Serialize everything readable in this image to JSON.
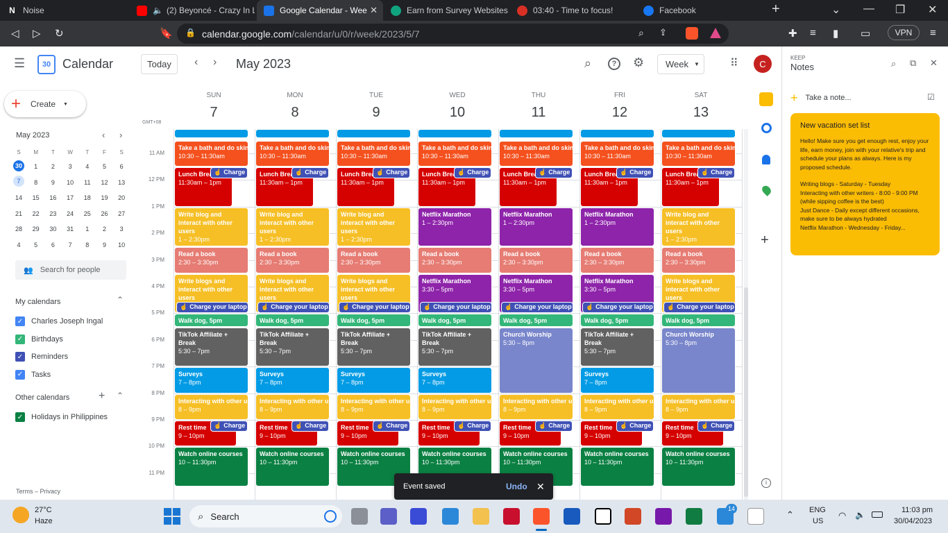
{
  "browser": {
    "tabs": [
      {
        "label": "Noise",
        "color": "#202124",
        "glyph": "N"
      },
      {
        "label": "(2) Beyoncé - Crazy In Lo",
        "color": "#ff0000",
        "glyph": "▶"
      },
      {
        "label": "Google Calendar - Wee",
        "color": "#1a73e8",
        "glyph": "30"
      },
      {
        "label": "Earn from Survey Websites.",
        "color": "#10a37f",
        "glyph": "◎"
      },
      {
        "label": "03:40 - Time to focus!",
        "color": "#d93025",
        "glyph": "✓"
      },
      {
        "label": "Facebook",
        "color": "#1877f2",
        "glyph": "f"
      }
    ],
    "url_domain": "calendar.google.com",
    "url_path": "/calendar/u/0/r/week/2023/5/7",
    "vpn_label": "VPN"
  },
  "calendar": {
    "app_name": "Calendar",
    "logo_day": "30",
    "today_button": "Today",
    "month_label": "May 2023",
    "view_select": "Week",
    "avatar_letter": "C",
    "timezone": "GMT+08",
    "days": [
      {
        "name": "SUN",
        "num": "7"
      },
      {
        "name": "MON",
        "num": "8"
      },
      {
        "name": "TUE",
        "num": "9"
      },
      {
        "name": "WED",
        "num": "10"
      },
      {
        "name": "THU",
        "num": "11"
      },
      {
        "name": "FRI",
        "num": "12"
      },
      {
        "name": "SAT",
        "num": "13"
      }
    ],
    "hours": [
      "11 AM",
      "12 PM",
      "1 PM",
      "2 PM",
      "3 PM",
      "4 PM",
      "5 PM",
      "6 PM",
      "7 PM",
      "8 PM",
      "9 PM",
      "10 PM",
      "11 PM"
    ]
  },
  "sidebar": {
    "create_label": "Create",
    "mini_month": "May 2023",
    "weekday_letters": [
      "S",
      "M",
      "T",
      "W",
      "T",
      "F",
      "S"
    ],
    "weeks": [
      [
        "30",
        "1",
        "2",
        "3",
        "4",
        "5",
        "6"
      ],
      [
        "7",
        "8",
        "9",
        "10",
        "11",
        "12",
        "13"
      ],
      [
        "14",
        "15",
        "16",
        "17",
        "18",
        "19",
        "20"
      ],
      [
        "21",
        "22",
        "23",
        "24",
        "25",
        "26",
        "27"
      ],
      [
        "28",
        "29",
        "30",
        "31",
        "1",
        "2",
        "3"
      ],
      [
        "4",
        "5",
        "6",
        "7",
        "8",
        "9",
        "10"
      ]
    ],
    "search_people": "Search for people",
    "my_calendars_title": "My calendars",
    "my_calendars": [
      {
        "label": "Charles Joseph Ingal",
        "color": "#4285f4"
      },
      {
        "label": "Birthdays",
        "color": "#33b679"
      },
      {
        "label": "Reminders",
        "color": "#3f51b5"
      },
      {
        "label": "Tasks",
        "color": "#4285f4"
      }
    ],
    "other_calendars_title": "Other calendars",
    "other_calendars": [
      {
        "label": "Holidays in Philippines",
        "color": "#0b8043"
      }
    ],
    "footer": "Terms – Privacy"
  },
  "events": {
    "bath_title": "Take a bath and do skin",
    "bath_time": "10:30 – 11:30am",
    "lunch_title": "Lunch Break",
    "lunch_time": "11:30am – 1pm",
    "charge_short": "Charge",
    "charge_long": "Charge your laptop",
    "blog_title": "Write blog and interact with other users",
    "blog_time": "1 – 2:30pm",
    "netflix_title": "Netflix Marathon",
    "netflix_time": "1 – 2:30pm",
    "netflix2_time": "3:30 – 5pm",
    "read_title": "Read a book",
    "read_time": "2:30 – 3:30pm",
    "blogs2_title": "Write blogs and interact with other users",
    "walk": "Walk dog, 5pm",
    "tiktok_title": "TikTok Affiliate + Break",
    "tiktok_time": "5:30 – 7pm",
    "church_title": "Church Worship",
    "church_time": "5:30 – 8pm",
    "surveys_title": "Surveys",
    "surveys_time": "7 – 8pm",
    "interact_title": "Interacting with other users",
    "interact_time": "8 – 9pm",
    "rest_title": "Rest time",
    "rest_time": "9 – 10pm",
    "watch_title": "Watch online courses",
    "watch_time": "10 – 11:30pm"
  },
  "keep": {
    "brand": "KEEP",
    "title": "Notes",
    "take_note": "Take a note...",
    "note_title": "New vacation set list",
    "note_body": "Hello! Make sure you get enough rest, enjoy your life, earn money, join with your relative's trip and schedule your plans as always. Here is my proposed schedule.",
    "note_lines": [
      "Writing blogs - Saturday - Tuesday",
      "Interacting with other writers - 8:00 - 9:00 PM (while sipping coffee is the best)",
      "Just Dance - Daily except different occasions, make sure to be always hydrated",
      "Netflix Marathon - Wednesday - Friday..."
    ]
  },
  "toast": {
    "message": "Event saved",
    "undo": "Undo"
  },
  "taskbar": {
    "weather_temp": "27°C",
    "weather_desc": "Haze",
    "search_label": "Search",
    "lang_top": "ENG",
    "lang_bottom": "US",
    "time": "11:03 pm",
    "date": "30/04/2023",
    "badge": "14"
  }
}
